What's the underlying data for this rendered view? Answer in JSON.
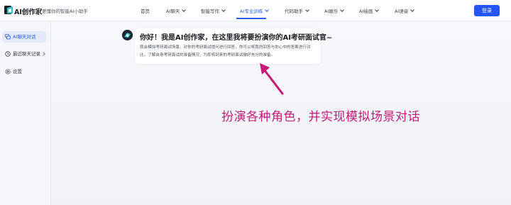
{
  "header": {
    "brand": "AI创作家",
    "tagline": "更懂你的智能AI小助手",
    "nav": [
      {
        "label": "首页",
        "dropdown": false,
        "active": false
      },
      {
        "label": "AI聊天",
        "dropdown": true,
        "active": false
      },
      {
        "label": "智能写作",
        "dropdown": true,
        "active": false
      },
      {
        "label": "AI专业训练",
        "dropdown": true,
        "active": true
      },
      {
        "label": "代码助手",
        "dropdown": true,
        "active": false
      },
      {
        "label": "AI娱乐",
        "dropdown": true,
        "active": false
      },
      {
        "label": "AI绘画",
        "dropdown": true,
        "active": false
      },
      {
        "label": "AI语音",
        "dropdown": true,
        "active": false
      }
    ],
    "login_label": "登录"
  },
  "sidebar": {
    "items": [
      {
        "label": "AI聊天对话",
        "icon": "chat-bubbles-icon",
        "active": true
      },
      {
        "label": "最近聊天记录",
        "icon": "clock-icon",
        "active": false
      },
      {
        "label": "设置",
        "icon": "gear-icon",
        "active": false
      }
    ]
  },
  "chat": {
    "greeting": "你好！我是AI创作家，在这里我将要扮演你的AI考研面试官~",
    "description": "我会模拟考研面试场景，对你的考研面试提问进行回答，你可以将我的回答与你心中的答案进行对比，了解自身考研面试的准备情况，为即将到来的考研面试做好充分的准备。"
  },
  "annotation": {
    "text": "扮演各种角色，并实现模拟场景对话",
    "color": "#c61a79"
  },
  "colors": {
    "accent": "#2457f2",
    "annotation": "#c61a79"
  }
}
